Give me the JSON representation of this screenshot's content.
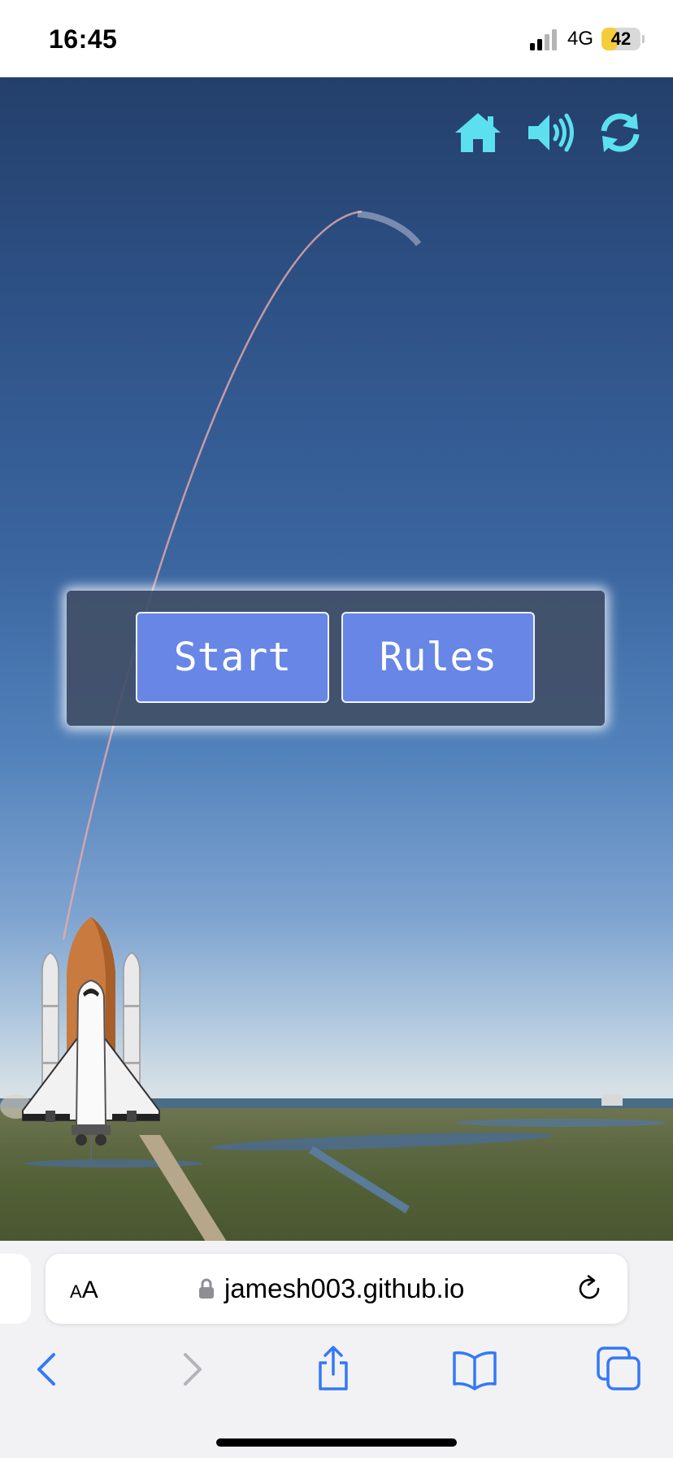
{
  "status_bar": {
    "time": "16:45",
    "network": "4G",
    "battery": "42",
    "battery_level": 0.42
  },
  "game": {
    "icons": [
      "home-icon",
      "speaker-icon",
      "refresh-icon"
    ],
    "icon_color": "#5ce0f0",
    "menu": {
      "start_label": "Start",
      "rules_label": "Rules",
      "button_color": "#6886e6"
    }
  },
  "browser": {
    "text_size_small": "A",
    "text_size_large": "A",
    "url": "jamesh003.github.io",
    "accent": "#3478f6"
  }
}
